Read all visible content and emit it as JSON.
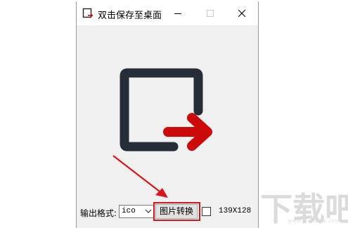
{
  "window": {
    "title": "双击保存至桌面",
    "controls": [
      "minimize",
      "maximize",
      "close"
    ]
  },
  "preview": {
    "icon": "export-icon",
    "frame_color": "#252d36",
    "arrow_color": "#cc0a0a"
  },
  "toolbar": {
    "format_label": "输出格式:",
    "format_value": "ico",
    "convert_label": "图片转换",
    "checkbox_checked": false,
    "image_size": "139X128"
  },
  "annotation": {
    "arrow_color": "#d9141b",
    "highlight_color": "#d9141b"
  },
  "watermark": {
    "text": "下载吧",
    "url": "www.xiazaiba.com"
  }
}
